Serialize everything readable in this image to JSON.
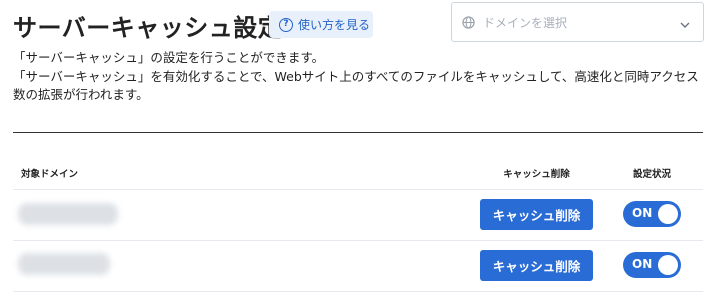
{
  "header": {
    "title": "サーバーキャッシュ設定",
    "help_label": "使い方を見る",
    "domain_select_placeholder": "ドメインを選択"
  },
  "description": {
    "line1": "「サーバーキャッシュ」の設定を行うことができます。",
    "line2": "「サーバーキャッシュ」を有効化することで、Webサイト上のすべてのファイルをキャッシュして、高速化と同時アクセス数の拡張が行われます。"
  },
  "table": {
    "columns": [
      "対象ドメイン",
      "キャッシュ削除",
      "設定状況"
    ],
    "rows": [
      {
        "purge_label": "キャッシュ削除",
        "status": "ON"
      },
      {
        "purge_label": "キャッシュ削除",
        "status": "ON"
      }
    ]
  },
  "colors": {
    "accent": "#2a6cd6",
    "help_bg": "#e8f0fb"
  },
  "icons": {
    "help": "question-circle-icon",
    "domain": "globe-icon",
    "dropdown": "chevron-down-icon"
  }
}
